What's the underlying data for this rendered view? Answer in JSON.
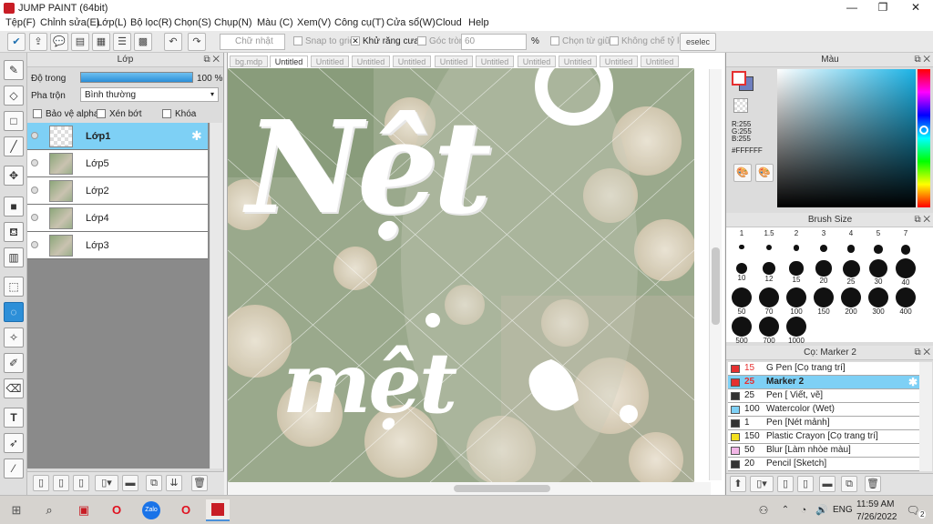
{
  "window": {
    "title": "JUMP PAINT (64bit)",
    "min": "—",
    "max": "❐",
    "close": "✕"
  },
  "menu": [
    "Tệp(F)",
    "Chỉnh sửa(E)",
    "Lớp(L)",
    "Bộ lọc(R)",
    "Chọn(S)",
    "Chụp(N)",
    "Màu (C)",
    "Xem(V)",
    "Công cụ(T)",
    "Cửa sổ(W)",
    "Cloud",
    "Help"
  ],
  "toolbar": {
    "shape_select": "Chữ nhật",
    "snap_label": "Snap to grid",
    "antialias_label": "Khử răng cưa",
    "antialias_checked": "✕",
    "round_corner_label": "Góc tròn",
    "round_corner_value": "60",
    "percent": "%",
    "select_from_center": "Chọn từ giữa",
    "no_limit_ratio": "Không chế tỷ lệ",
    "deselect": "eselec"
  },
  "layer_panel": {
    "title": "Lớp",
    "opacity_label": "Độ trong",
    "opacity_value": "100 %",
    "opacity_fraction": 1.0,
    "blend_label": "Pha trộn",
    "blend_value": "Bình thường",
    "protect_alpha": "Bảo vệ alpha",
    "clipping": "Xén bớt",
    "lock": "Khóa",
    "layers": [
      {
        "name": "Lớp1",
        "selected": true,
        "transparent": true
      },
      {
        "name": "Lớp5",
        "selected": false,
        "transparent": false
      },
      {
        "name": "Lớp2",
        "selected": false,
        "transparent": false
      },
      {
        "name": "Lớp4",
        "selected": false,
        "transparent": false
      },
      {
        "name": "Lớp3",
        "selected": false,
        "transparent": false
      }
    ]
  },
  "tabs": [
    "bg.mdp",
    "Untitled",
    "Untitled",
    "Untitled",
    "Untitled",
    "Untitled",
    "Untitled",
    "Untitled",
    "Untitled",
    "Untitled",
    "Untitled"
  ],
  "active_tab_index": 1,
  "canvas_text": {
    "line1": "Nệt",
    "line2": "mệt"
  },
  "color_panel": {
    "title": "Màu",
    "r": "R:255",
    "g": "G:255",
    "b": "B:255",
    "hex": "#FFFFFF",
    "foreground": "#ffffff",
    "background": "#6f7fbf"
  },
  "brush_size_panel": {
    "title": "Brush Size",
    "sizes": [
      "1",
      "1.5",
      "2",
      "3",
      "4",
      "5",
      "7",
      "10",
      "12",
      "15",
      "20",
      "25",
      "30",
      "40",
      "50",
      "70",
      "100",
      "150",
      "200",
      "300",
      "400",
      "500",
      "700",
      "1000"
    ]
  },
  "brush_panel": {
    "title": "Cọ: Marker 2",
    "brushes": [
      {
        "size": "15",
        "name": "G Pen [Cọ trang trí]",
        "color": "#e53030",
        "selected": false
      },
      {
        "size": "25",
        "name": "Marker 2",
        "color": "#e53030",
        "selected": true
      },
      {
        "size": "25",
        "name": "Pen [ Viết, vẽ]",
        "color": "#333333",
        "selected": false
      },
      {
        "size": "100",
        "name": "Watercolor (Wet)",
        "color": "#7ed0f5",
        "selected": false
      },
      {
        "size": "1",
        "name": "Pen [Nét mảnh]",
        "color": "#333333",
        "selected": false
      },
      {
        "size": "150",
        "name": "Plastic Crayon [Cọ trang trí]",
        "color": "#f4e020",
        "selected": false
      },
      {
        "size": "50",
        "name": "Blur [Làm nhòe màu]",
        "color": "#f2b6e6",
        "selected": false
      },
      {
        "size": "20",
        "name": "Pencil [Sketch]",
        "color": "#333333",
        "selected": false
      }
    ]
  },
  "taskbar": {
    "time": "11:59 AM",
    "date": "7/26/2022",
    "lang": "ENG",
    "notif": "2"
  }
}
